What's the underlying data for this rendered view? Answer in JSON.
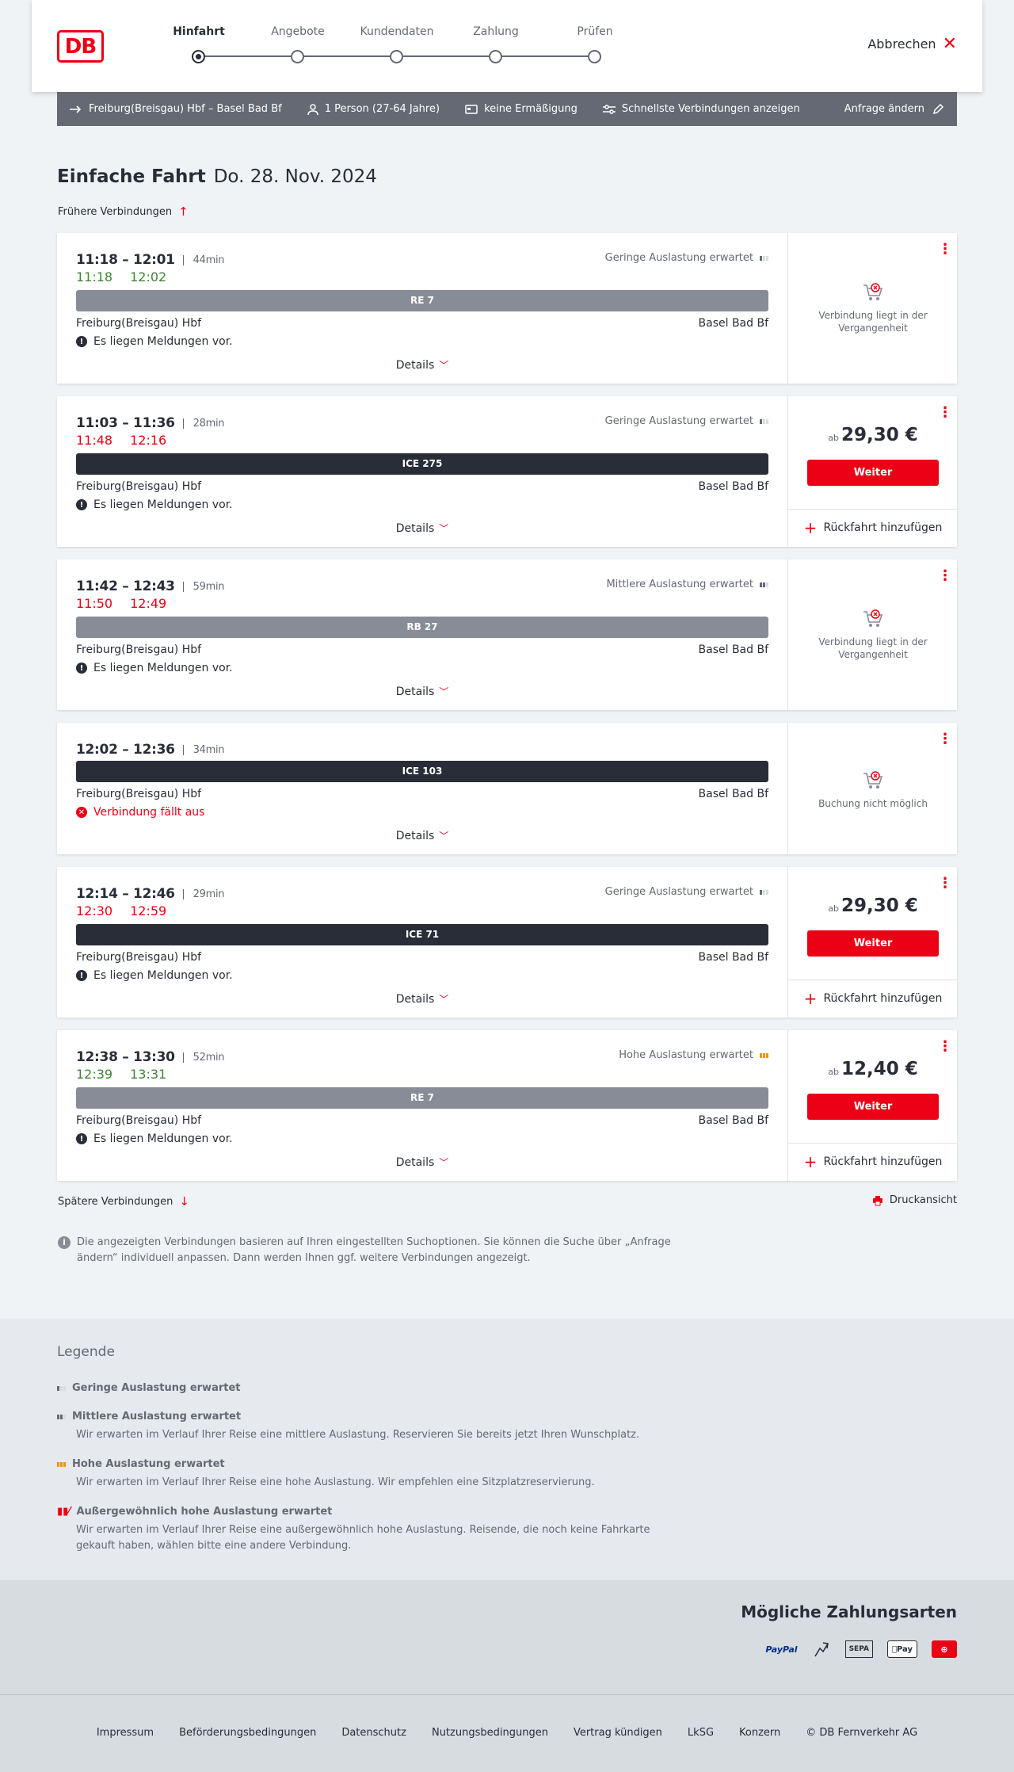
{
  "header": {
    "logo_text": "DB",
    "steps": [
      {
        "label": "Hinfahrt",
        "active": true
      },
      {
        "label": "Angebote",
        "active": false
      },
      {
        "label": "Kundendaten",
        "active": false
      },
      {
        "label": "Zahlung",
        "active": false
      },
      {
        "label": "Prüfen",
        "active": false
      }
    ],
    "cancel_label": "Abbrechen"
  },
  "search": {
    "route": "Freiburg(Breisgau) Hbf – Basel Bad Bf",
    "passengers": "1 Person (27-64 Jahre)",
    "discount": "keine Ermäßigung",
    "fastest": "Schnellste Verbindungen anzeigen",
    "change": "Anfrage ändern"
  },
  "page": {
    "title": "Einfache Fahrt",
    "date": "Do. 28. Nov. 2024",
    "earlier": "Frühere Verbindungen",
    "later": "Spätere Verbindungen",
    "print": "Druckansicht",
    "info_note": "Die angezeigten Verbindungen basieren auf Ihren eingestellten Suchoptionen. Sie können die Suche über „Anfrage ändern“ individuell anpassen. Dann werden Ihnen ggf. weitere Verbindungen angezeigt."
  },
  "common": {
    "details": "Details",
    "from": "Freiburg(Breisgau) Hbf",
    "to": "Basel Bad Bf",
    "weiter": "Weiter",
    "return_add": "Rückfahrt hinzufügen",
    "price_prefix": "ab"
  },
  "connections": [
    {
      "time": "11:18 – 12:01",
      "duration": "44min",
      "rt_dep": "11:18",
      "rt_arr": "12:02",
      "rt_color": "green",
      "load": "Geringe Auslastung erwartet",
      "load_level": 1,
      "train": "RE 7",
      "train_style": "gray",
      "message": "Es liegen Meldungen vor.",
      "side": "Verbindung liegt in der Vergangenheit"
    },
    {
      "time": "11:03 – 11:36",
      "duration": "28min",
      "rt_dep": "11:48",
      "rt_arr": "12:16",
      "rt_color": "red",
      "load": "Geringe Auslastung erwartet",
      "load_level": 1,
      "train": "ICE 275",
      "train_style": "dark",
      "message": "Es liegen Meldungen vor.",
      "price": "29,30 €"
    },
    {
      "time": "11:42 – 12:43",
      "duration": "59min",
      "rt_dep": "11:50",
      "rt_arr": "12:49",
      "rt_color": "red",
      "load": "Mittlere Auslastung erwartet",
      "load_level": 2,
      "train": "RB 27",
      "train_style": "gray",
      "message": "Es liegen Meldungen vor.",
      "side": "Verbindung liegt in der Vergangenheit"
    },
    {
      "time": "12:02 – 12:36",
      "duration": "34min",
      "train": "ICE 103",
      "train_style": "dark",
      "message": "Verbindung fällt aus",
      "side": "Buchung nicht möglich"
    },
    {
      "time": "12:14 – 12:46",
      "duration": "29min",
      "rt_dep": "12:30",
      "rt_arr": "12:59",
      "rt_color": "red",
      "load": "Geringe Auslastung erwartet",
      "load_level": 1,
      "train": "ICE 71",
      "train_style": "dark",
      "message": "Es liegen Meldungen vor.",
      "price": "29,30 €"
    },
    {
      "time": "12:38 – 13:30",
      "duration": "52min",
      "rt_dep": "12:39",
      "rt_arr": "13:31",
      "rt_color": "green",
      "load": "Hohe Auslastung erwartet",
      "load_level": 3,
      "train": "RE 7",
      "train_style": "gray",
      "message": "Es liegen Meldungen vor.",
      "price": "12,40 €"
    }
  ],
  "legend": {
    "title": "Legende",
    "items": [
      {
        "head": "Geringe Auslastung erwartet",
        "desc": ""
      },
      {
        "head": "Mittlere Auslastung erwartet",
        "desc": "Wir erwarten im Verlauf Ihrer Reise eine mittlere Auslastung. Reservieren Sie bereits jetzt Ihren Wunschplatz."
      },
      {
        "head": "Hohe Auslastung erwartet",
        "desc": "Wir erwarten im Verlauf Ihrer Reise eine hohe Auslastung. Wir empfehlen eine Sitzplatzreservierung."
      },
      {
        "head": "Außergewöhnlich hohe Auslastung erwartet",
        "desc": "Wir erwarten im Verlauf Ihrer Reise eine außergewöhnlich hohe Auslastung. Reisende, die noch keine Fahrkarte gekauft haben, wählen bitte eine andere Verbindung."
      }
    ]
  },
  "payments": {
    "title": "Mögliche Zahlungsarten",
    "paypal": "PayPal",
    "sepa": "SEPA",
    "applepay": "Pay"
  },
  "footer": {
    "links": [
      "Impressum",
      "Beförderungsbedingungen",
      "Datenschutz",
      "Nutzungsbedingungen",
      "Vertrag kündigen",
      "LkSG",
      "Konzern",
      "© DB Fernverkehr AG"
    ]
  },
  "colors": {
    "accent": "#ec0016",
    "green": "#408335",
    "dark": "#282d37",
    "gray": "#646973"
  }
}
